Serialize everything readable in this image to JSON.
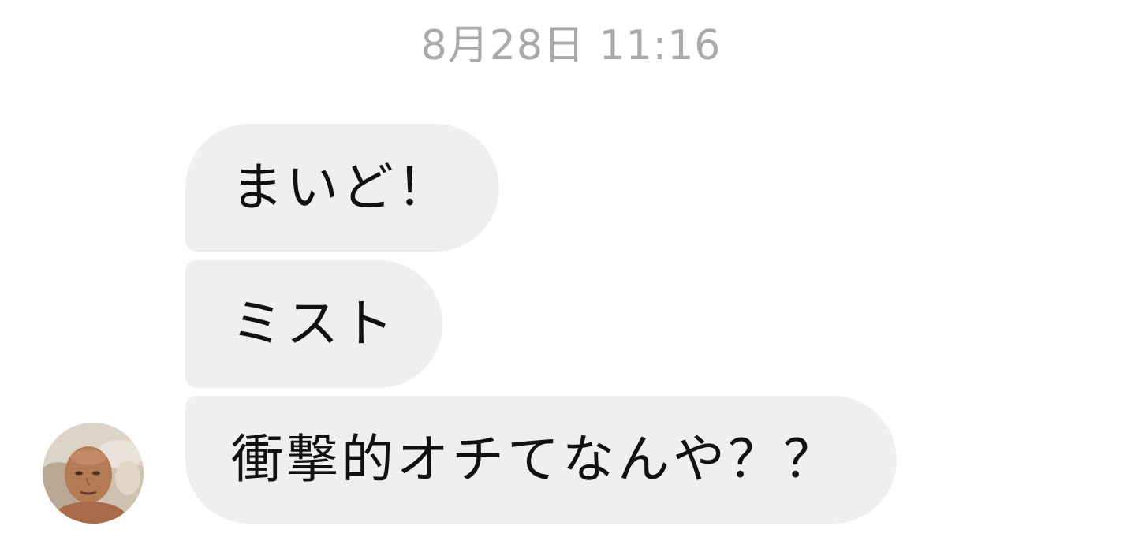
{
  "conversation": {
    "timestamp": "8月28日 11:16",
    "messages": [
      {
        "text": "まいど！"
      },
      {
        "text": "ミスト"
      },
      {
        "text": "衝撃的オチてなんや？？"
      }
    ]
  },
  "colors": {
    "background": "#ffffff",
    "bubble": "#efefef",
    "text": "#111111",
    "timestamp": "#a9a9ab"
  },
  "icons": {
    "avatar": "user-avatar-photo"
  }
}
